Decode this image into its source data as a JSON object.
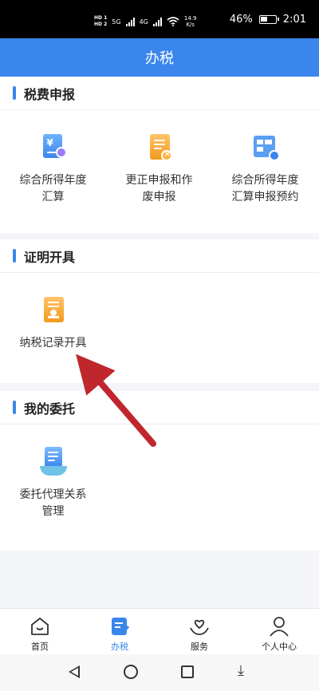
{
  "status_bar": {
    "hd1": "HD 1",
    "hd2": "HD 2",
    "net5g": "5G",
    "net4g": "4G",
    "speed_value": "14.9",
    "speed_unit": "K/s",
    "battery": "46%",
    "battery_level": 0.46,
    "time": "2:01"
  },
  "header": {
    "title": "办税"
  },
  "sections": [
    {
      "title": "税费申报",
      "items": [
        {
          "label": "综合所得年度汇算",
          "icon": "tax-document-yuan-icon"
        },
        {
          "label": "更正申报和作废申报",
          "icon": "correction-document-icon"
        },
        {
          "label": "综合所得年度汇算申报预约",
          "icon": "calendar-appointment-icon"
        }
      ]
    },
    {
      "title": "证明开具",
      "items": [
        {
          "label": "纳税记录开具",
          "icon": "certificate-document-icon"
        }
      ]
    },
    {
      "title": "我的委托",
      "items": [
        {
          "label": "委托代理关系管理",
          "icon": "delegation-hand-icon"
        }
      ]
    }
  ],
  "tabs": [
    {
      "label": "首页",
      "icon": "home-icon",
      "active": false
    },
    {
      "label": "办税",
      "icon": "tax-edit-icon",
      "active": true
    },
    {
      "label": "服务",
      "icon": "heart-hand-icon",
      "active": false
    },
    {
      "label": "个人中心",
      "icon": "person-icon",
      "active": false
    }
  ],
  "colors": {
    "accent": "#3a86ec",
    "orange": "#f39a1e",
    "arrow": "#c0272d"
  }
}
